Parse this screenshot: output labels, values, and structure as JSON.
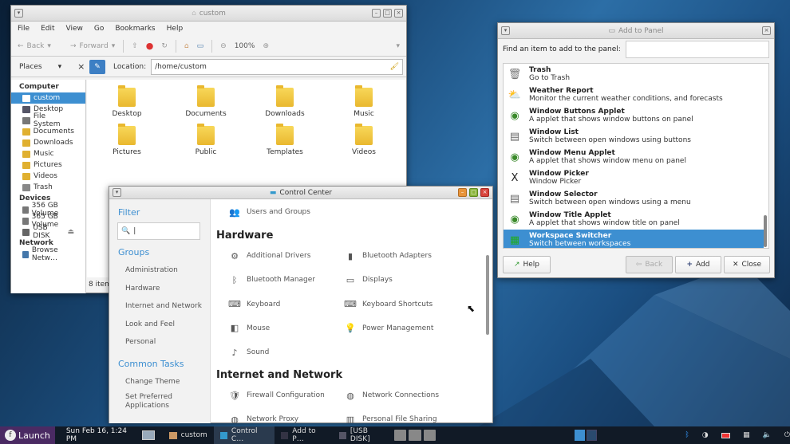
{
  "fm": {
    "title": "custom",
    "menu": [
      "File",
      "Edit",
      "View",
      "Go",
      "Bookmarks",
      "Help"
    ],
    "toolbar": {
      "back": "Back",
      "forward": "Forward",
      "zoom": "100%"
    },
    "places_label": "Places",
    "location_label": "Location:",
    "location_value": "/home/custom",
    "status": "8 item",
    "sidebar": [
      {
        "type": "header",
        "label": "Computer"
      },
      {
        "type": "item",
        "label": "custom",
        "selected": true,
        "icon": "home-icon"
      },
      {
        "type": "item",
        "label": "Desktop",
        "icon": "desktop-icon"
      },
      {
        "type": "item",
        "label": "File System",
        "icon": "drive-icon"
      },
      {
        "type": "item",
        "label": "Documents",
        "icon": "folder-icon"
      },
      {
        "type": "item",
        "label": "Downloads",
        "icon": "folder-icon"
      },
      {
        "type": "item",
        "label": "Music",
        "icon": "folder-icon"
      },
      {
        "type": "item",
        "label": "Pictures",
        "icon": "folder-icon"
      },
      {
        "type": "item",
        "label": "Videos",
        "icon": "folder-icon"
      },
      {
        "type": "item",
        "label": "Trash",
        "icon": "trash-icon"
      },
      {
        "type": "header",
        "label": "Devices"
      },
      {
        "type": "item",
        "label": "356 GB Volume",
        "icon": "drive-icon"
      },
      {
        "type": "item",
        "label": "365 GB Volume",
        "icon": "drive-icon"
      },
      {
        "type": "item",
        "label": "USB DISK",
        "icon": "usb-icon",
        "eject": "⏏"
      },
      {
        "type": "header",
        "label": "Network"
      },
      {
        "type": "item",
        "label": "Browse Netw…",
        "icon": "network-icon"
      }
    ],
    "files": [
      "Desktop",
      "Documents",
      "Downloads",
      "Music",
      "Pictures",
      "Public",
      "Templates",
      "Videos"
    ]
  },
  "cc": {
    "title": "Control Center",
    "filter_label": "Filter",
    "search_placeholder": "|",
    "groups_label": "Groups",
    "groups": [
      "Administration",
      "Hardware",
      "Internet and Network",
      "Look and Feel",
      "Personal"
    ],
    "common_label": "Common Tasks",
    "common": [
      "Change Theme",
      "Set Preferred Applications"
    ],
    "top_item": "Users and Groups",
    "hardware_label": "Hardware",
    "hardware": [
      "Additional Drivers",
      "Bluetooth Adapters",
      "Bluetooth Manager",
      "Displays",
      "Keyboard",
      "Keyboard Shortcuts",
      "Mouse",
      "Power Management",
      "Sound"
    ],
    "internet_label": "Internet and Network",
    "internet": [
      "Firewall Configuration",
      "Network Connections",
      "Network Proxy",
      "Personal File Sharing"
    ]
  },
  "atp": {
    "title": "Add to Panel",
    "find_label": "Find an item to add to the panel:",
    "items": [
      {
        "name": "Trash",
        "desc": "Go to Trash",
        "icon": "trash-icon",
        "glyph": "🗑"
      },
      {
        "name": "Weather Report",
        "desc": "Monitor the current weather conditions, and forecasts",
        "icon": "weather-icon",
        "glyph": "⛅"
      },
      {
        "name": "Window Buttons Applet",
        "desc": "A applet that shows window buttons on panel",
        "icon": "applet-icon",
        "glyph": "◉"
      },
      {
        "name": "Window List",
        "desc": "Switch between open windows using buttons",
        "icon": "window-list-icon",
        "glyph": "▤"
      },
      {
        "name": "Window Menu Applet",
        "desc": "A applet that shows window menu on panel",
        "icon": "applet-icon",
        "glyph": "◉"
      },
      {
        "name": "Window Picker",
        "desc": "Window Picker",
        "icon": "x-icon",
        "glyph": "X"
      },
      {
        "name": "Window Selector",
        "desc": "Switch between open windows using a menu",
        "icon": "window-selector-icon",
        "glyph": "▤"
      },
      {
        "name": "Window Title Applet",
        "desc": "A applet that shows window title on panel",
        "icon": "applet-icon",
        "glyph": "◉"
      },
      {
        "name": "Workspace Switcher",
        "desc": "Switch between workspaces",
        "icon": "workspace-icon",
        "glyph": "▦",
        "selected": true
      }
    ],
    "help": "Help",
    "back": "Back",
    "add": "Add",
    "close": "Close"
  },
  "panel": {
    "launch": "Launch",
    "datetime": "Sun Feb 16,  1:24 PM",
    "tasks": [
      "custom",
      "Control C…",
      "Add to P…",
      "[USB DISK]"
    ]
  }
}
